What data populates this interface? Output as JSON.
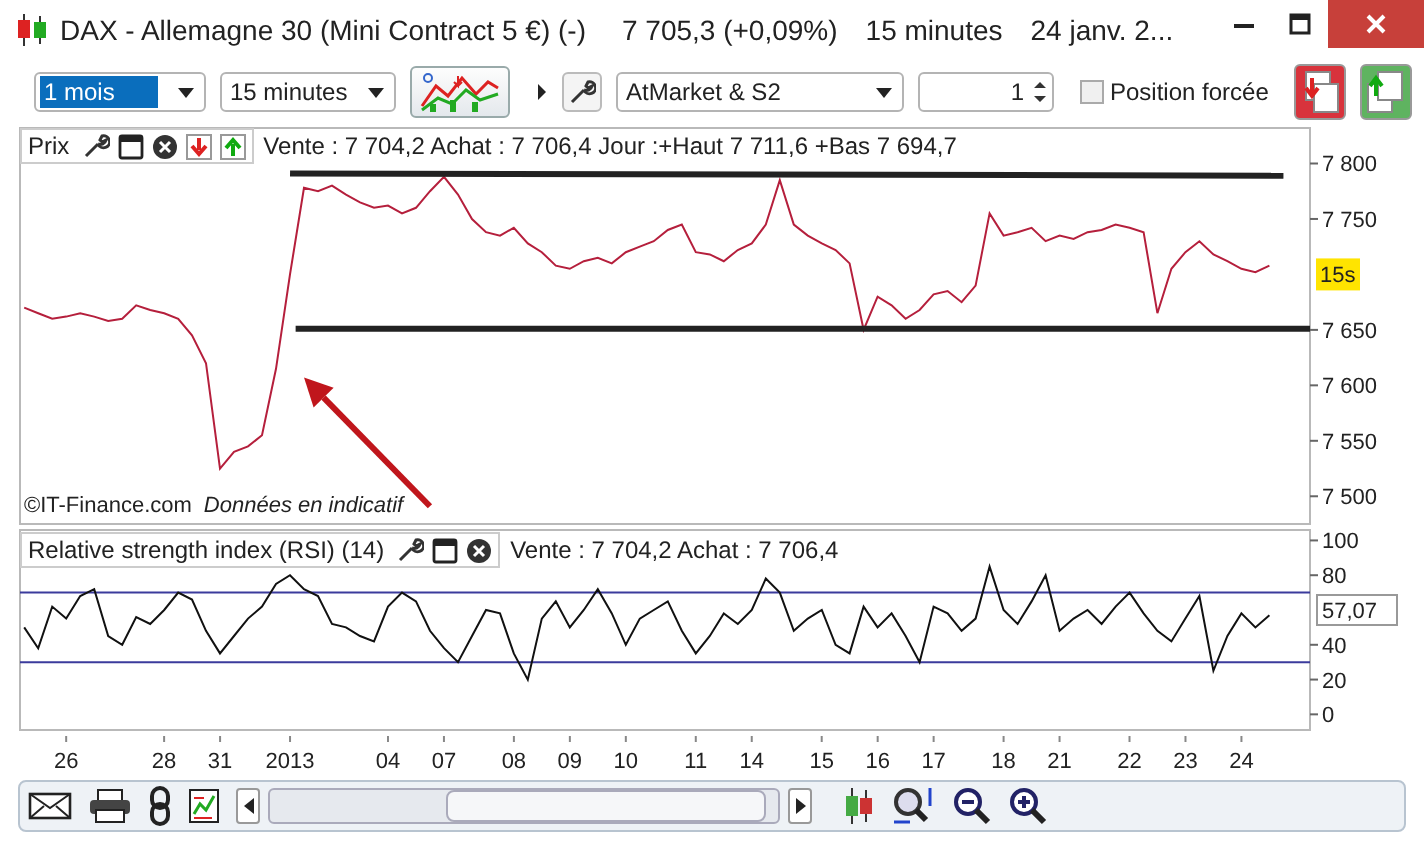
{
  "window": {
    "title": "DAX - Allemagne 30 (Mini Contract 5 €) (-)",
    "quote": "7 705,3 (+0,09%)",
    "interval": "15 minutes",
    "date": "24 janv. 2..."
  },
  "toolbar": {
    "period": {
      "value": "1 mois",
      "focused": true
    },
    "interval": "15 minutes",
    "strategy": "AtMarket & S2",
    "quantity": "1",
    "forced_position": {
      "label": "Position forcée",
      "checked": false
    }
  },
  "price_panel": {
    "label": "Prix",
    "info": "Vente : 7 704,2 Achat : 7 706,4 Jour :+Haut 7 711,6 +Bas 7 694,7",
    "source": "©IT-Finance.com",
    "disclaimer": "Données en indicatif",
    "time_tag": "15s",
    "drawings": [
      {
        "kind": "line"
      },
      {
        "kind": "line"
      },
      {
        "kind": "arrow"
      }
    ],
    "chart_data": {
      "type": "line",
      "ylim": [
        7475,
        7832
      ],
      "yticks": [
        {
          "value": 7500,
          "label": "7 500"
        },
        {
          "value": 7550,
          "label": "7 550"
        },
        {
          "value": 7600,
          "label": "7 600"
        },
        {
          "value": 7650,
          "label": "7 650"
        },
        {
          "value": 7750,
          "label": "7 750"
        },
        {
          "value": 7800,
          "label": "7 800"
        }
      ],
      "series": [
        {
          "color": "#b51f3c",
          "values": [
            7670,
            7665,
            7660,
            7662,
            7665,
            7662,
            7658,
            7660,
            7672,
            7668,
            7665,
            7660,
            7645,
            7620,
            7525,
            7540,
            7545,
            7555,
            7615,
            7700,
            7778,
            7775,
            7780,
            7772,
            7765,
            7760,
            7762,
            7755,
            7760,
            7775,
            7788,
            7772,
            7750,
            7738,
            7735,
            7742,
            7728,
            7720,
            7708,
            7705,
            7712,
            7715,
            7710,
            7720,
            7725,
            7730,
            7740,
            7745,
            7720,
            7718,
            7712,
            7722,
            7728,
            7745,
            7785,
            7745,
            7735,
            7728,
            7722,
            7710,
            7650,
            7680,
            7672,
            7660,
            7668,
            7682,
            7685,
            7675,
            7690,
            7755,
            7735,
            7738,
            7742,
            7730,
            7735,
            7732,
            7738,
            7740,
            7745,
            7742,
            7738,
            7665,
            7705,
            7720,
            7730,
            7718,
            7712,
            7705,
            7702,
            7708
          ]
        }
      ]
    }
  },
  "rsi_panel": {
    "label": "Relative strength index (RSI) (14)",
    "info": "Vente : 7 704,2 Achat : 7 706,4",
    "value_tag": "57,07",
    "chart_data": {
      "type": "line",
      "ylim": [
        -9,
        106
      ],
      "categories": [
        null,
        null,
        null,
        "26",
        null,
        null,
        null,
        null,
        null,
        null,
        "28",
        null,
        null,
        null,
        "31",
        null,
        null,
        null,
        null,
        "2013",
        null,
        null,
        null,
        null,
        null,
        null,
        "04",
        null,
        null,
        null,
        "07",
        null,
        null,
        null,
        null,
        "08",
        null,
        null,
        null,
        "09",
        null,
        null,
        null,
        "10",
        null,
        null,
        null,
        null,
        "11",
        null,
        null,
        null,
        "14",
        null,
        null,
        null,
        null,
        "15",
        null,
        null,
        null,
        "16",
        null,
        null,
        null,
        "17",
        null,
        null,
        null,
        null,
        "18",
        null,
        null,
        null,
        "21",
        null,
        null,
        null,
        null,
        "22",
        null,
        null,
        null,
        "23",
        null,
        null,
        null,
        "24",
        null,
        null
      ],
      "yticks": [
        {
          "value": 0,
          "label": "0"
        },
        {
          "value": 20,
          "label": "20"
        },
        {
          "value": 40,
          "label": "40"
        },
        {
          "value": 80,
          "label": "80"
        },
        {
          "value": 100,
          "label": "100"
        }
      ],
      "series": [
        {
          "color": "#111111",
          "values": [
            50,
            38,
            62,
            55,
            68,
            72,
            45,
            40,
            56,
            52,
            60,
            70,
            66,
            48,
            35,
            45,
            55,
            62,
            75,
            80,
            72,
            68,
            52,
            50,
            45,
            42,
            62,
            70,
            65,
            48,
            38,
            30,
            45,
            60,
            58,
            35,
            20,
            55,
            65,
            50,
            60,
            72,
            58,
            40,
            55,
            60,
            65,
            48,
            35,
            45,
            58,
            52,
            60,
            78,
            70,
            48,
            55,
            60,
            40,
            35,
            62,
            50,
            58,
            45,
            30,
            62,
            58,
            48,
            55,
            85,
            60,
            52,
            65,
            80,
            48,
            55,
            60,
            52,
            62,
            70,
            58,
            48,
            42,
            55,
            68,
            25,
            45,
            58,
            50,
            57
          ]
        }
      ],
      "ref_lines": [
        {
          "axis": "y",
          "value": 70,
          "color": "#3b3b9c"
        },
        {
          "axis": "y",
          "value": 30,
          "color": "#3b3b9c"
        }
      ]
    }
  }
}
